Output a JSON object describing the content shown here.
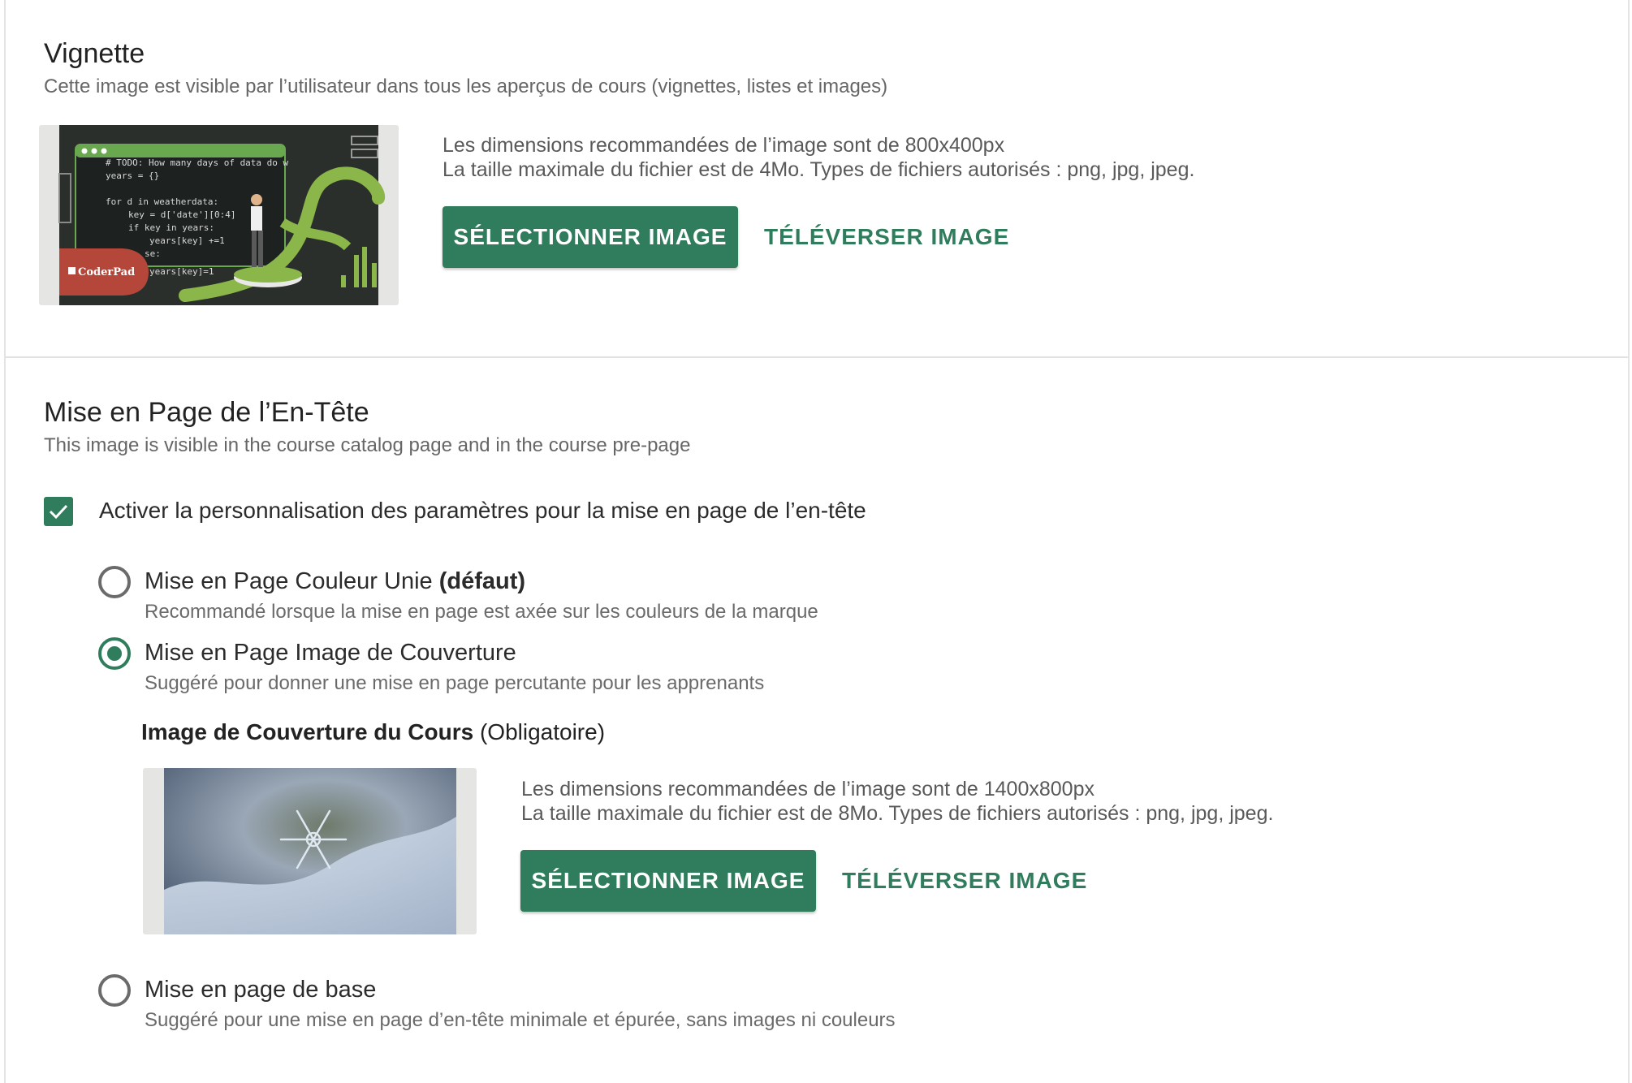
{
  "thumbnail": {
    "title": "Vignette",
    "subtitle": "Cette image est visible par l’utilisateur dans tous les aperçus de cours (vignettes, listes et images)",
    "code_lines": [
      "# TODO: How many days of data do w",
      "years = {}",
      "for d in weatherdata:",
      "key = d['date'][0:4]",
      "if key in years:",
      "years[key] +=1",
      "se:",
      "years[key]=1"
    ],
    "brand": "CoderPad",
    "info_line1": "Les dimensions recommandées de l’image sont de 800x400px",
    "info_line2": "La taille maximale du fichier est de 4Mo. Types de fichiers autorisés : png, jpg, jpeg.",
    "select_label": "SÉLECTIONNER IMAGE",
    "upload_label": "TÉLÉVERSER IMAGE"
  },
  "header_layout": {
    "title": "Mise en Page de l’En-Tête",
    "subtitle": "This image is visible in the course catalog page and in the course pre-page",
    "customize_label": "Activer la personnalisation des paramètres pour la mise en page de l’en-tête",
    "customize_checked": true,
    "options": [
      {
        "label": "Mise en Page Couleur Unie",
        "label_suffix": "(défaut)",
        "description": "Recommandé lorsque la mise en page est axée sur les couleurs de la marque",
        "selected": false
      },
      {
        "label": "Mise en Page Image de Couverture",
        "label_suffix": "",
        "description": "Suggéré pour donner une mise en page percutante pour les apprenants",
        "selected": true
      },
      {
        "label": "Mise en page de base",
        "label_suffix": "",
        "description": "Suggéré pour une mise en page d’en-tête minimale et épurée, sans images ni couleurs",
        "selected": false
      }
    ],
    "cover": {
      "label": "Image de Couverture du Cours",
      "label_suffix": "(Obligatoire)",
      "info_line1": "Les dimensions recommandées de l’image sont de 1400x800px",
      "info_line2": "La taille maximale du fichier est de 8Mo. Types de fichiers autorisés : png, jpg, jpeg.",
      "select_label": "SÉLECTIONNER IMAGE",
      "upload_label": "TÉLÉVERSER IMAGE"
    }
  },
  "colors": {
    "accent": "#2f7d5c",
    "brand_badge": "#b5473a"
  }
}
